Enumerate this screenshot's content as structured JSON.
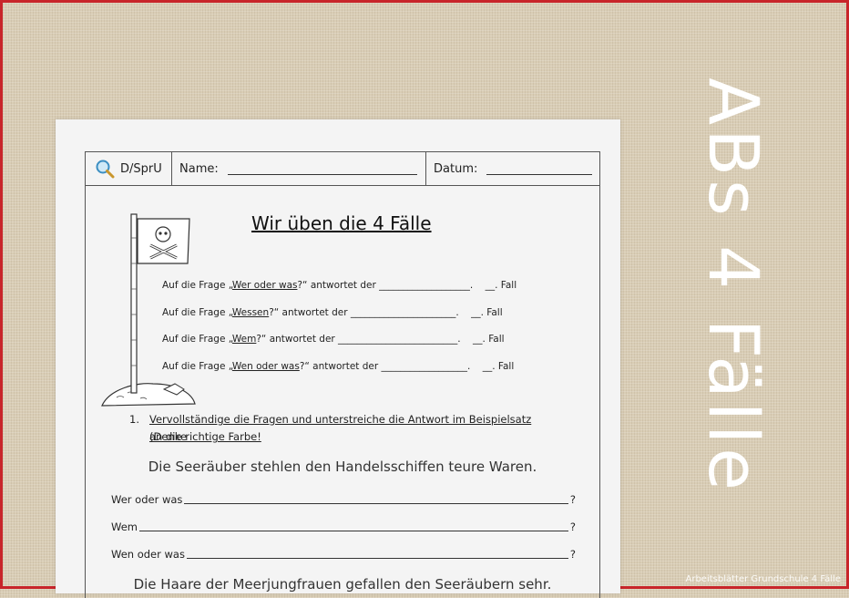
{
  "side_title": "ABs 4 Fälle",
  "watermark": "Arbeitsblätter Grundschule 4 Fälle",
  "header": {
    "subject": "D/SprU",
    "name_label": "Name:",
    "date_label": "Datum:"
  },
  "worksheet": {
    "title": "Wir üben die 4 Fälle",
    "questions": [
      {
        "prefix": "Auf die Frage „",
        "question": "Wer oder was",
        "suffix": "?“ antwortet der ___________________.",
        "case": "__. Fall"
      },
      {
        "prefix": "Auf die Frage „",
        "question": "Wessen",
        "suffix": "?“ antwortet der ______________________.",
        "case": "__. Fall"
      },
      {
        "prefix": "Auf die Frage „",
        "question": "Wem",
        "suffix": "?“ antwortet der _________________________.",
        "case": "__. Fall"
      },
      {
        "prefix": "Auf die Frage „",
        "question": "Wen oder was",
        "suffix": "?“ antwortet der __________________.",
        "case": "__. Fall"
      }
    ],
    "task_number": "1.",
    "task_line1": "Vervollständige die Fragen und unterstreiche die Antwort im Beispielsatz (Denke",
    "task_line2": "an die richtige Farbe!",
    "sentence1": "Die Seeräuber stehlen den Handelsschiffen teure Waren.",
    "answers": [
      {
        "label": "Wer oder was",
        "end": "?"
      },
      {
        "label": "Wem",
        "end": "?"
      },
      {
        "label": "Wen oder was",
        "end": "?"
      }
    ],
    "sentence2": "Die Haare der Meerjungfrauen gefallen den Seeräubern sehr."
  }
}
